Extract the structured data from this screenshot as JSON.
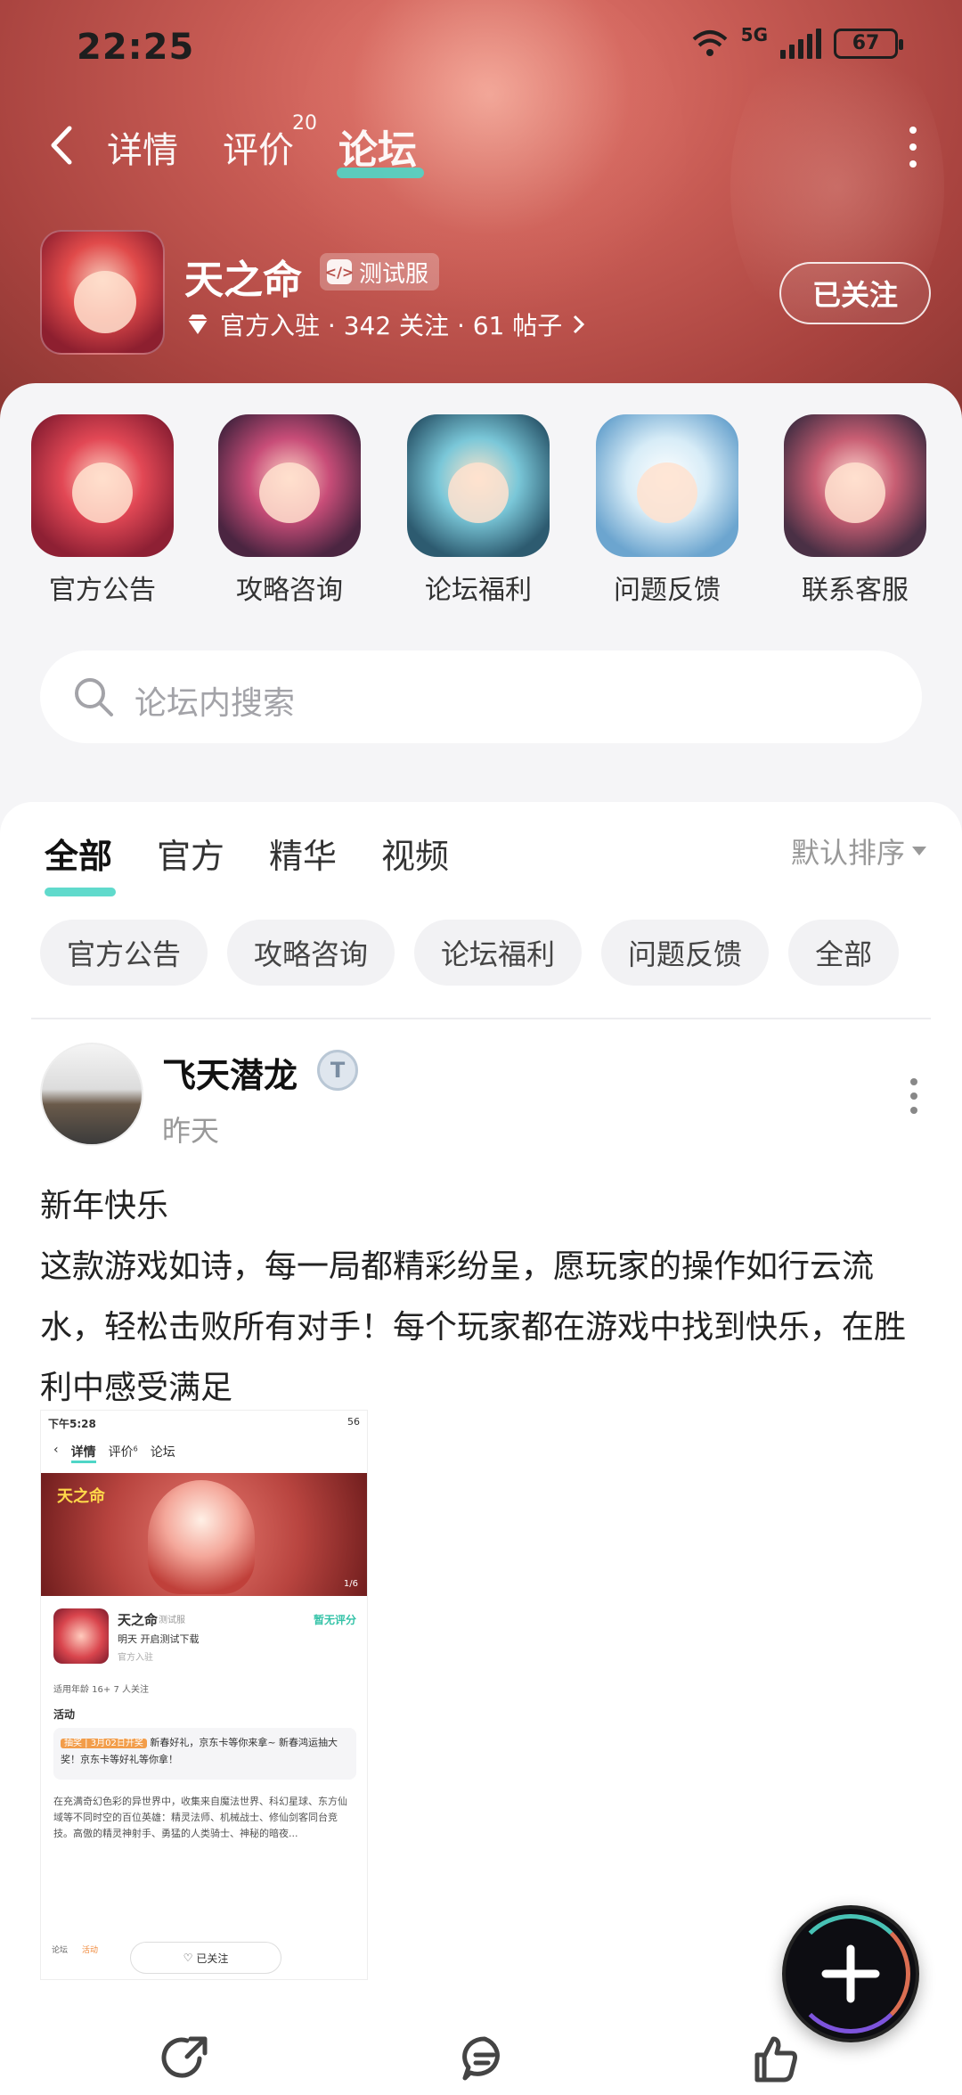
{
  "status_bar": {
    "time": "22:25",
    "network": "5G",
    "battery": "67"
  },
  "nav": {
    "tabs": [
      {
        "label": "详情"
      },
      {
        "label": "评价",
        "badge": "20"
      },
      {
        "label": "论坛"
      }
    ],
    "active_tab": "论坛",
    "accent_color": "#4fd6c7"
  },
  "game": {
    "name": "天之命",
    "badge": "测试服",
    "meta": "官方入驻 · 342 关注 · 61 帖子",
    "follow_label": "已关注"
  },
  "categories": [
    {
      "label": "官方公告"
    },
    {
      "label": "攻略咨询"
    },
    {
      "label": "论坛福利"
    },
    {
      "label": "问题反馈"
    },
    {
      "label": "联系客服"
    }
  ],
  "search": {
    "placeholder": "论坛内搜索"
  },
  "feed": {
    "tabs": [
      {
        "label": "全部"
      },
      {
        "label": "官方"
      },
      {
        "label": "精华"
      },
      {
        "label": "视频"
      }
    ],
    "sort_label": "默认排序",
    "chips": [
      {
        "label": "官方公告"
      },
      {
        "label": "攻略咨询"
      },
      {
        "label": "论坛福利"
      },
      {
        "label": "问题反馈"
      },
      {
        "label": "全部"
      }
    ]
  },
  "post": {
    "author": "飞天潜龙",
    "time": "昨天",
    "title": "新年快乐",
    "body": "这款游戏如诗，每一局都精彩纷呈，愿玩家的操作如行云流水，轻松击败所有对手！每个玩家都在游戏中找到快乐，在胜利中感受满足",
    "image": {
      "status_time": "下午5:28",
      "status_right": "56",
      "tabs": [
        "详情",
        "评价",
        "论坛"
      ],
      "review_badge": "6",
      "logo": "天之命",
      "page": "1/6",
      "game_name": "天之命",
      "game_badge": "测试服",
      "subtitle": "明天 开启测试下载",
      "official": "官方入驻",
      "score": "暂无评分",
      "meta": "适用年龄 16+   7 人关注",
      "activity": "活动",
      "promo_tag": "抽奖 | 3月02日开奖",
      "promo_text": "新春好礼，京东卡等你来拿~ 新春鸿运抽大奖！京东卡等好礼等你拿！",
      "desc": "在充满奇幻色彩的异世界中，收集来自魔法世界、科幻星球、东方仙域等不同时空的百位英雄：精灵法师、机械战士、修仙剑客同台竞技。高傲的精灵神射手、勇猛的人类骑士、神秘的暗夜...",
      "bottom_items": [
        "论坛",
        "活动"
      ],
      "follow": "已关注"
    }
  },
  "fab": {
    "icon": "plus-icon"
  }
}
